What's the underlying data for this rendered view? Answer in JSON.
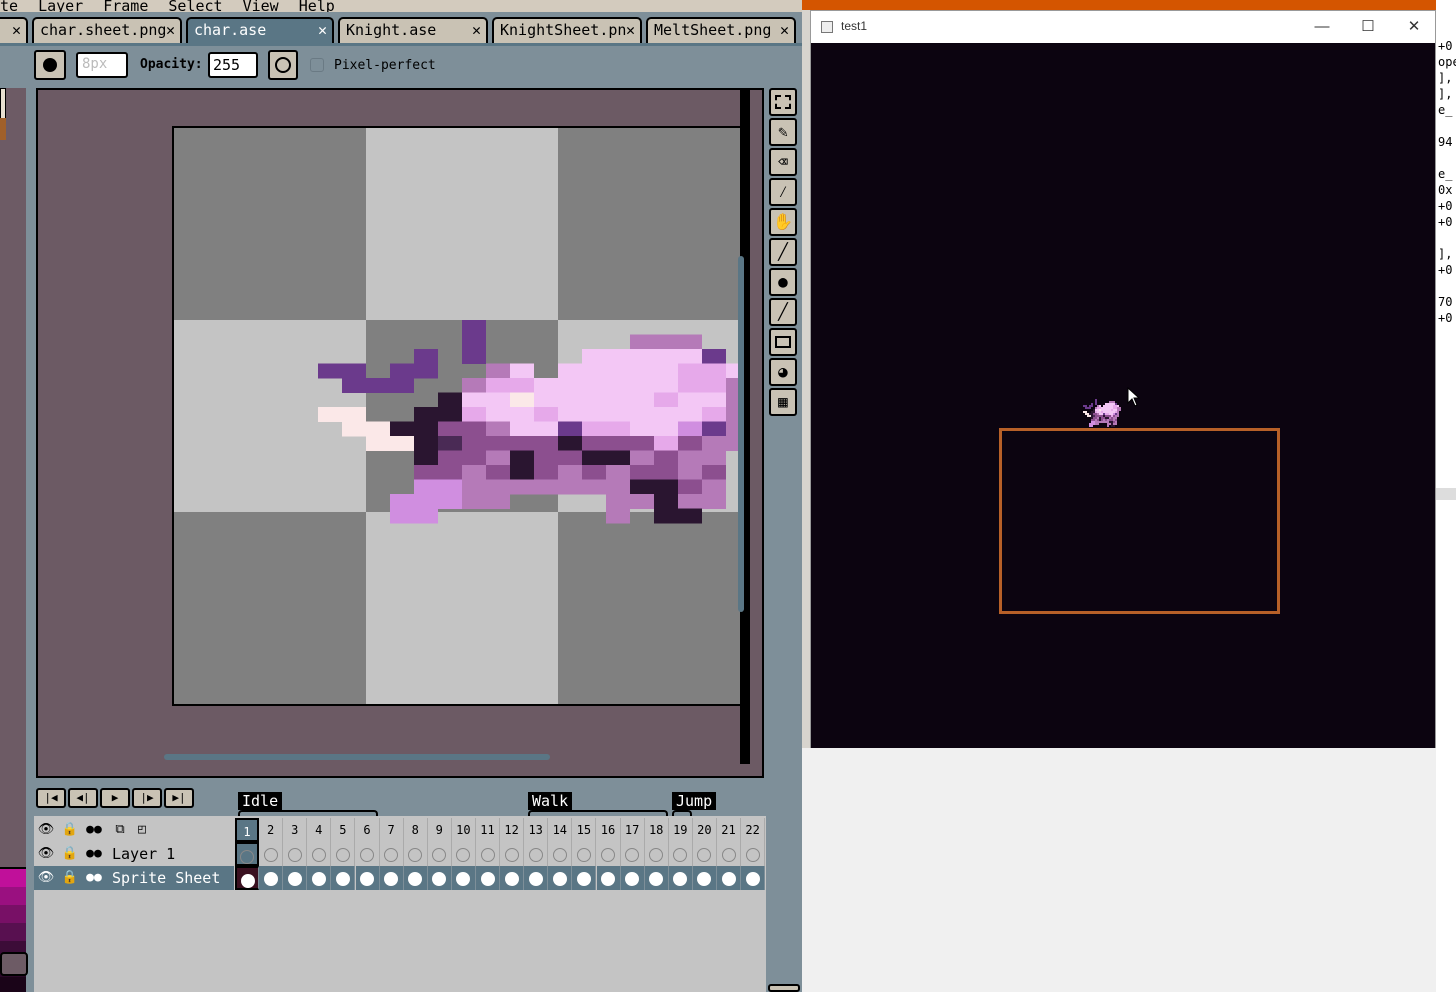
{
  "aseprite": {
    "menu": [
      {
        "first": "",
        "rest": "te"
      },
      {
        "first": "L",
        "rest": "ayer"
      },
      {
        "first": "F",
        "rest": "rame"
      },
      {
        "first": "S",
        "rest": "elect"
      },
      {
        "first": "V",
        "rest": "iew"
      },
      {
        "first": "H",
        "rest": "elp"
      }
    ],
    "tabs": [
      {
        "label": "char.sheet.png",
        "active": false
      },
      {
        "label": "char.ase",
        "active": true
      },
      {
        "label": "Knight.ase",
        "active": false
      },
      {
        "label": "KnightSheet.pn",
        "active": false
      },
      {
        "label": "MeltSheet.png",
        "active": false
      }
    ],
    "tab_close_glyph": "✕",
    "context_bar": {
      "brush_size": "8px",
      "opacity_label": "Opacity:",
      "opacity_value": "255",
      "pixel_perfect_label": "Pixel-perfect"
    },
    "timeline": {
      "tags": [
        {
          "name": "Idle"
        },
        {
          "name": "Walk"
        },
        {
          "name": "Jump"
        }
      ],
      "frames": [
        "1",
        "2",
        "3",
        "4",
        "5",
        "6",
        "7",
        "8",
        "9",
        "10",
        "11",
        "12",
        "13",
        "14",
        "15",
        "16",
        "17",
        "18",
        "19",
        "20",
        "21",
        "22"
      ],
      "current_frame": "1",
      "layers": [
        {
          "name": "Layer 1",
          "selected": false
        },
        {
          "name": "Sprite Sheet",
          "selected": true
        }
      ]
    },
    "colors": {
      "panel": "#7e8f99",
      "canvas_bg": "#6c5a64",
      "accent": "#5a7685"
    }
  },
  "game_window": {
    "title": "test1",
    "minimize": "—",
    "maximize": "☐",
    "close": "✕",
    "background": "#0c0410",
    "platform_color": "#b76028"
  },
  "side_text": [
    "+0",
    "ope",
    "],",
    "],",
    "e_",
    "",
    "94",
    "",
    "e_",
    "0x",
    "+0",
    "+0",
    "",
    "],",
    "+0",
    "",
    "70",
    "+0"
  ]
}
